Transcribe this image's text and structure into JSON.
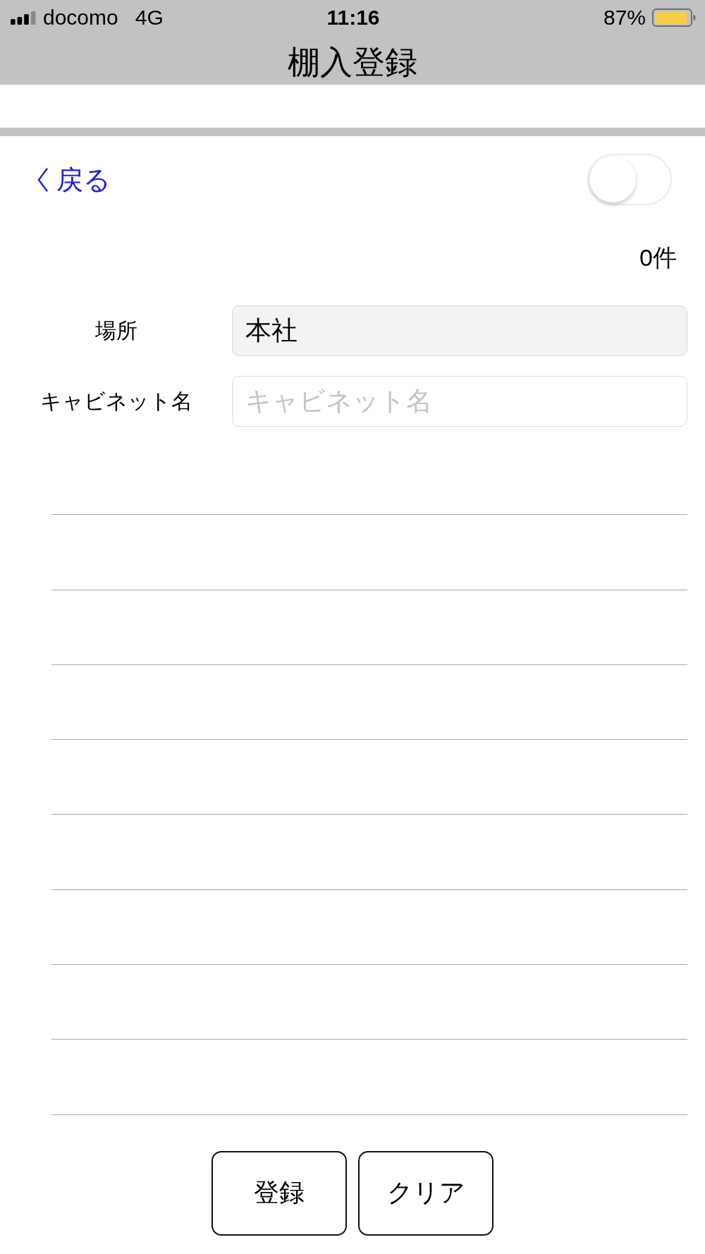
{
  "status_bar": {
    "carrier": "docomo",
    "network": "4G",
    "time": "11:16",
    "battery": "87%"
  },
  "nav_bar": {
    "title": "棚入登録"
  },
  "controls": {
    "back_button": "戻る",
    "toggle": {
      "on": false
    }
  },
  "count": "0件",
  "form": {
    "fields": [
      {
        "label": "場所",
        "value": "本社",
        "disabled": true
      },
      {
        "label": "キャビネット名",
        "placeholder": "キャビネット名",
        "disabled": false
      }
    ]
  },
  "buttons": [
    "登録",
    "クリア"
  ]
}
